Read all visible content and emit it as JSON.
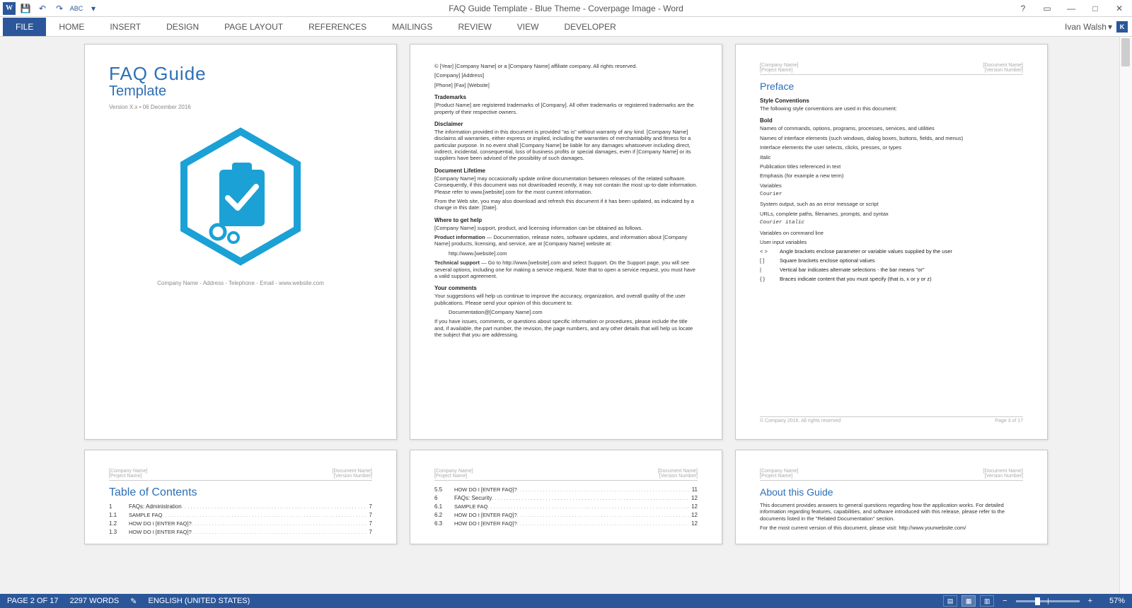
{
  "titlebar": {
    "title": "FAQ Guide Template - Blue Theme - Coverpage Image - Word"
  },
  "ribbon": {
    "file": "FILE",
    "tabs": [
      "HOME",
      "INSERT",
      "DESIGN",
      "PAGE LAYOUT",
      "REFERENCES",
      "MAILINGS",
      "REVIEW",
      "VIEW",
      "DEVELOPER"
    ],
    "user": "Ivan Walsh",
    "user_initial": "K"
  },
  "status": {
    "page": "PAGE 2 OF 17",
    "words": "2297 WORDS",
    "lang": "ENGLISH (UNITED STATES)",
    "zoom": "57%"
  },
  "hdr": {
    "left1": "[Company Name]",
    "left2": "[Project Name]",
    "right1": "[Document Name]",
    "right2": "[Version Number]"
  },
  "ftr": {
    "left": "© Company 2016. All rights reserved",
    "right": "Page 3 of 17"
  },
  "cover": {
    "title": "FAQ Guide",
    "subtitle": "Template",
    "version": "Version X.x • 06 December 2016",
    "footer": "Company Name - Address - Telephone - Email - www.website.com"
  },
  "p2": {
    "copyright": "© [Year] [Company Name] or a [Company Name] affiliate company. All rights reserved.",
    "addr": "[Company] [Address]",
    "contact": "[Phone] [Fax] [Website]",
    "trademarks_h": "Trademarks",
    "trademarks": "[Product Name] are registered trademarks of [Company]. All other trademarks or registered trademarks are the property of their respective owners.",
    "disclaimer_h": "Disclaimer",
    "disclaimer": "The information provided in this document is provided \"as is\" without warranty of any kind. [Company Name] disclaims all warranties, either express or implied, including the warranties of merchantability and fitness for a particular purpose. In no event shall [Company Name] be liable for any damages whatsoever including direct, indirect, incidental, consequential, loss of business profits or special damages, even if [Company Name] or its suppliers have been advised of the possibility of such damages.",
    "lifetime_h": "Document Lifetime",
    "lifetime1": "[Company Name] may occasionally update online documentation between releases of the related software. Consequently, if this document was not downloaded recently, it may not contain the most up-to-date information. Please refer to www.[website].com for the most current information.",
    "lifetime2": "From the Web site, you may also download and refresh this document if it has been updated, as indicated by a change in this date: [Date].",
    "help_h": "Where to get help",
    "help": "[Company Name] support, product, and licensing information can be obtained as follows.",
    "prodinfo_h": "Product information",
    "prodinfo": " — Documentation, release notes, software updates, and information about [Company Name] products, licensing, and service, are at [Company Name] website at:",
    "prodinfo_url": "http://www.[website].com",
    "tech_h": "Technical support",
    "tech": " — Go to http://www.[website].com and select Support. On the Support page, you will see several options, including one for making a service request. Note that to open a service request, you must have a valid support agreement.",
    "comments_h": "Your comments",
    "comments1": "Your suggestions will help us continue to improve the accuracy, organization, and overall quality of the user publications. Please send your opinion of this document to:",
    "comments_email": "Documentation@[Company Name].com",
    "comments2": "If you have issues, comments, or questions about specific information or procedures, please include the title and, if available, the part number, the revision, the page numbers, and any other details that will help us locate the subject that you are addressing."
  },
  "p3": {
    "title": "Preface",
    "style_h": "Style Conventions",
    "style_intro": "The following style conventions are used in this document:",
    "bold_h": "Bold",
    "bold1": "Names of commands, options, programs, processes, services, and utilities",
    "bold2": "Names of interface elements (such windows, dialog boxes, buttons, fields, and menus)",
    "bold3": "Interface elements the user selects, clicks, presses, or types",
    "italic_h": "Italic",
    "italic1": "Publication titles referenced in text",
    "italic2": "Emphasis (for example a new term)",
    "italic3": "Variables",
    "courier_h": "Courier",
    "courier1": "System output, such as an error message or script",
    "courier2": "URLs, complete paths, filenames, prompts, and syntax",
    "courieri_h": "Courier italic",
    "courieri1": "Variables on command line",
    "courieri2": "User input variables",
    "sym1": "< >",
    "sym1_t": "Angle brackets enclose parameter or variable values supplied by the user",
    "sym2": "[ ]",
    "sym2_t": "Square brackets enclose optional values",
    "sym3": "|",
    "sym3_t": "Vertical bar indicates alternate selections - the bar means \"or\"",
    "sym4": "{ }",
    "sym4_t": "Braces indicate content that you must specify (that is, x or y or z)"
  },
  "toc": {
    "title": "Table of Contents",
    "lines": [
      {
        "n": "1",
        "t": "FAQs: Administration",
        "p": "7"
      },
      {
        "n": "1.1",
        "t": "SAMPLE FAQ",
        "p": "7"
      },
      {
        "n": "1.2",
        "t": "HOW DO I [ENTER FAQ]?",
        "p": "7"
      },
      {
        "n": "1.3",
        "t": "HOW DO I [ENTER FAQ]?",
        "p": "7"
      }
    ]
  },
  "toc2": {
    "lines": [
      {
        "n": "5.5",
        "t": "HOW DO I [ENTER FAQ]?",
        "p": "11"
      },
      {
        "n": "6",
        "t": "FAQs: Security",
        "p": "12"
      },
      {
        "n": "6.1",
        "t": "SAMPLE FAQ",
        "p": "12"
      },
      {
        "n": "6.2",
        "t": "HOW DO I [ENTER FAQ]?",
        "p": "12"
      },
      {
        "n": "6.3",
        "t": "HOW DO I [ENTER FAQ]?",
        "p": "12"
      }
    ]
  },
  "about": {
    "title": "About this Guide",
    "p1": "This document provides answers to general questions regarding how the application works. For detailed information regarding features, capabilities, and software introduced with this release, please refer to the documents listed in the \"Related Documentation\" section.",
    "p2": "For the most current version of this document, please visit: http://www.yourwebsite.com/"
  }
}
